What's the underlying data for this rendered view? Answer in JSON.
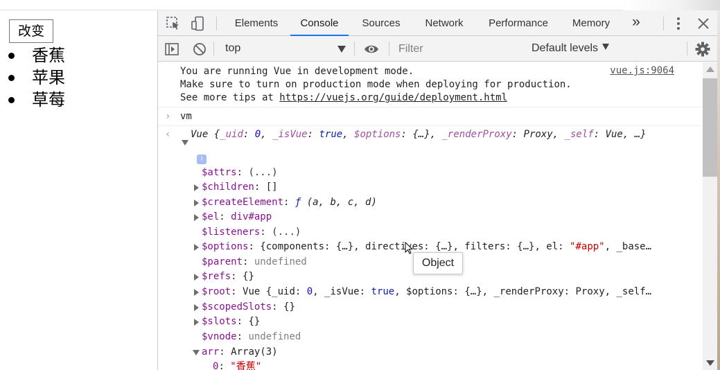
{
  "page": {
    "button_label": "改变",
    "fruits": [
      "香蕉",
      "苹果",
      "草莓"
    ]
  },
  "devtools": {
    "tabs": [
      "Elements",
      "Console",
      "Sources",
      "Network",
      "Performance",
      "Memory"
    ],
    "active_tab": "Console",
    "more_tabs": "»",
    "console_bar": {
      "context": "top",
      "filter_placeholder": "Filter",
      "levels": "Default levels"
    },
    "message": {
      "lines": [
        "You are running Vue in development mode.",
        "Make sure to turn on production mode when deploying for production.",
        "See more tips at "
      ],
      "url": "https://vuejs.org/guide/deployment.html",
      "source": "vue.js:9064"
    },
    "input_expr": "vm",
    "summary": {
      "class_name": "Vue",
      "open": " {",
      "p1_key": "_uid",
      "p1_val": "0",
      "p2_key": "_isVue",
      "p2_val": "true",
      "p3_key": "$options",
      "p3_val": "{…}",
      "p4_key": "_renderProxy",
      "p4_val": "Proxy",
      "p5_key": "_self",
      "p5_val": "Vue",
      "tail": ", …}"
    },
    "info_badge": "i",
    "props": {
      "attrs_key": "$attrs",
      "attrs_val": "(...)",
      "children_key": "$children",
      "children_val": "[]",
      "createElement_key": "$createElement",
      "createElement_f": "ƒ",
      "createElement_val": " (a, b, c, d)",
      "el_key": "$el",
      "el_val": "div#app",
      "listeners_key": "$listeners",
      "listeners_val": "(...)",
      "options_key": "$options",
      "options_pre": "{components: {…}, directives: {…}, filters: {…}, el: ",
      "options_str": "\"#app\"",
      "options_post": ", _base…",
      "parent_key": "$parent",
      "parent_val": "undefined",
      "refs_key": "$refs",
      "refs_val": "{}",
      "root_key": "$root",
      "root_pre": "Vue {_uid: ",
      "root_num": "0",
      "root_mid": ", _isVue: ",
      "root_bool": "true",
      "root_post": ", $options: {…}, _renderProxy: Proxy, _self…",
      "scopedSlots_key": "$scopedSlots",
      "scopedSlots_val": "{}",
      "slots_key": "$slots",
      "slots_val": "{}",
      "vnode_key": "$vnode",
      "vnode_val": "undefined",
      "arr_key": "arr",
      "arr_val": "Array(3)",
      "arr0_key": "0",
      "arr0_val": "\"香蕉\""
    },
    "tooltip": "Object"
  }
}
